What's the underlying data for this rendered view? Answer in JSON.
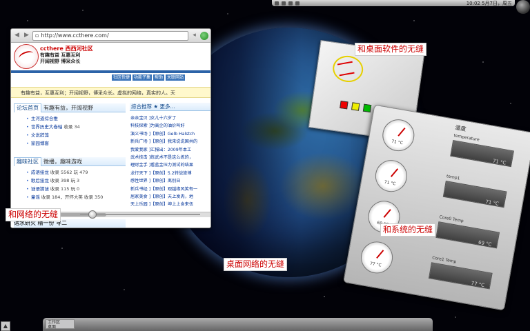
{
  "top_panel": {
    "clock": "10:02 5月7日，周五"
  },
  "browser": {
    "url": "http://www.ccthere.com/",
    "site_name": "ccthere 西西河社区",
    "slogan_1": "有趣有益  互惠互利",
    "slogan_2": "开阔视野  博采众长",
    "nav": [
      "社区快捷",
      "功能子集",
      "帮助",
      "关联网站"
    ],
    "motto": "有趣有益，互惠互利；开阔视野，博采众长。虚拟的网络，真实的人。天",
    "forum_section": {
      "tab": "论坛首页",
      "subtitle": "有趣有益，开阔视野"
    },
    "forum_items": [
      {
        "name": "主河道综合推",
        "meta": ""
      },
      {
        "name": "世界历史大卷轴",
        "meta": "收录 34"
      },
      {
        "name": "文说辞藻",
        "meta": ""
      },
      {
        "name": "家园博客",
        "meta": ""
      }
    ],
    "fun_section": {
      "tab": "趣味社区",
      "subtitle": "微播，趣味游戏"
    },
    "fun_items": [
      {
        "name": "成语接龙",
        "meta": "收录 5562 玩 479"
      },
      {
        "name": "歌后接龙",
        "meta": "收录 398 玩 3"
      },
      {
        "name": "谜语猜谜",
        "meta": "收录 115 玩 0"
      },
      {
        "name": "童谣",
        "meta": "收录 184，开怀大笑  收录 350"
      }
    ],
    "news_head": "综合推荐 ★   更多...",
    "news_items": [
      "亲亲宝贝 ]女儿十六岁了",
      "科技探索 ]为高企的油价叫好",
      "演义书场 ]【原创】Gelb Halstch",
      "新兵广场 ]【原创】我来说说国共的",
      "我爱我家 ]汇报出：2009年本工",
      "武术技击 ]练武术不是这么练的，",
      "理财金手 ]看蓝金压力测试的结果",
      "龙行天下 ]【原创】5.2转战旅博",
      "感性世界 ]【原创】离别日",
      "新兵书经 ]【原创】观越缘风笑有一",
      "居家美食 ]【原创】天上发肉，地",
      "天上乐园 ]【原创】坤上上食来伍"
    ],
    "bottom_cut": "诸水研火  精一份  寻二"
  },
  "callouts": {
    "desktop_software": "和桌面软件的无缝",
    "network": "和网络的无缝",
    "system": "和系统的无缝",
    "desktop_network": "桌面网络的无缝"
  },
  "temp_widget": {
    "title": "温度",
    "sensors": [
      {
        "label": "temperature",
        "gauge": "71 °C",
        "value": "71 °C"
      },
      {
        "label": "temp1",
        "gauge": "71 °C",
        "value": "71 °C"
      },
      {
        "label": "Core0 Temp",
        "gauge": "69 °C",
        "value": "69 °C"
      },
      {
        "label": "Core1 Temp",
        "gauge": "77 °C",
        "value": "77 °C"
      }
    ]
  },
  "bottom_panel": {
    "task_1": "工作区",
    "task_2": "桌面"
  },
  "colors": {
    "accent": "#3a73b8",
    "callout_text": "#cc0000",
    "note_swatches": [
      "#ee0000",
      "#eeee00",
      "#00bb00",
      "#0022ee"
    ]
  }
}
